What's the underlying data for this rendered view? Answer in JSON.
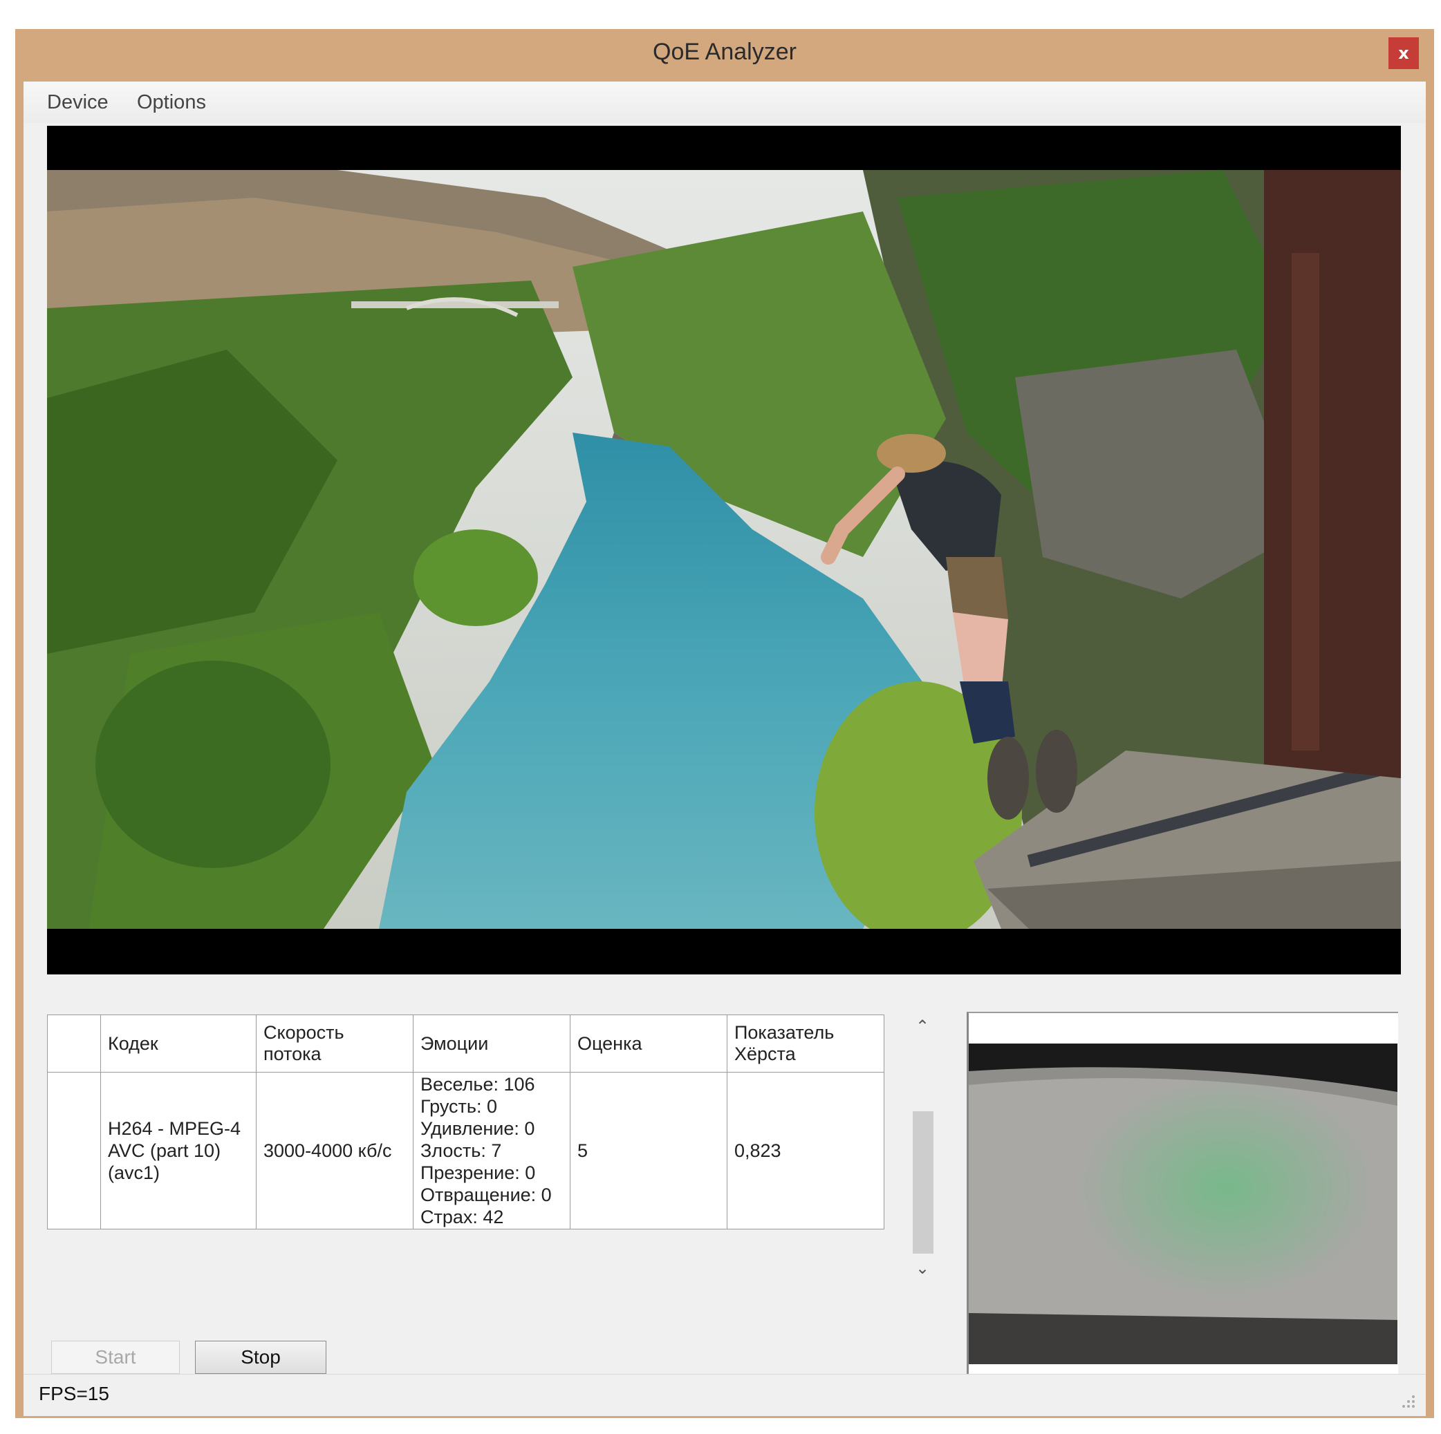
{
  "window": {
    "title": "QoE Analyzer",
    "close_glyph": "x"
  },
  "menu": {
    "items": [
      "Device",
      "Options"
    ]
  },
  "table": {
    "headers": [
      "",
      "Кодек",
      "Скорость\nпотока",
      "Эмоции",
      "Оценка",
      "Показатель\nХёрста"
    ],
    "row": {
      "codec": "H264 - MPEG-4 AVC (part 10) (avc1)",
      "bitrate": "3000-4000 кб/с",
      "emotions": [
        "Веселье: 106",
        "Грусть: 0",
        "Удивление: 0",
        "Злость: 7",
        "Презрение: 0",
        "Отвращение: 0",
        "Страх: 42"
      ],
      "score": "5",
      "hurst": "0,823"
    }
  },
  "buttons": {
    "start": "Start",
    "stop": "Stop"
  },
  "status": {
    "fps": "FPS=15"
  },
  "icons": {
    "close": "close-icon",
    "scroll_up": "chevron-up-icon",
    "scroll_down": "chevron-down-icon",
    "grip": "resize-grip-icon"
  },
  "colors": {
    "frame": "#d3a87e",
    "close": "#c63d37",
    "water": "#3f9fb3",
    "foliage": "#4d7a2c"
  }
}
